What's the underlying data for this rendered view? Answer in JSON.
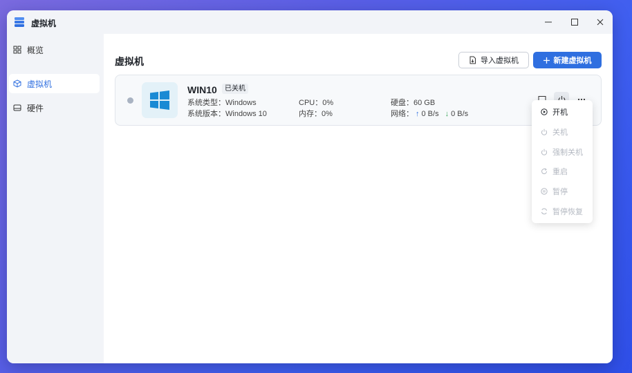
{
  "window": {
    "title": "虚拟机"
  },
  "sidebar": {
    "items": [
      {
        "label": "概览",
        "icon": "grid-icon",
        "active": false
      },
      {
        "label": "虚拟机",
        "icon": "cube-icon",
        "active": true
      },
      {
        "label": "硬件",
        "icon": "drive-icon",
        "active": false
      }
    ]
  },
  "main": {
    "title": "虚拟机",
    "import_label": "导入虚拟机",
    "new_label": "新建虚拟机"
  },
  "vm": {
    "name": "WIN10",
    "status": "已关机",
    "os_type_label": "系统类型：",
    "os_type": "Windows",
    "os_version_label": "系统版本：",
    "os_version": "Windows 10",
    "cpu_label": "CPU：",
    "cpu": "0%",
    "memory_label": "内存：",
    "memory": "0%",
    "disk_label": "硬盘：",
    "disk": "60 GB",
    "network_label": "网络：",
    "upload": "0 B/s",
    "download": "0 B/s"
  },
  "menu": {
    "items": [
      {
        "label": "开机",
        "enabled": true
      },
      {
        "label": "关机",
        "enabled": false
      },
      {
        "label": "强制关机",
        "enabled": false
      },
      {
        "label": "重启",
        "enabled": false
      },
      {
        "label": "暂停",
        "enabled": false
      },
      {
        "label": "暂停恢复",
        "enabled": false
      }
    ]
  },
  "colors": {
    "accent": "#2f6fe0",
    "status_off": "#a9b3c2",
    "download": "#3aa55a",
    "windows_logo": "#1a8ad4"
  }
}
